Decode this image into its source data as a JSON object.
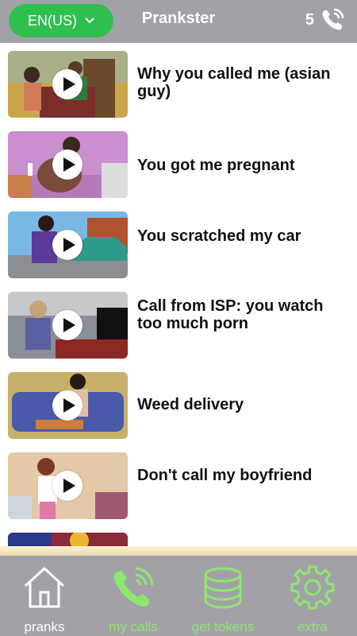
{
  "header": {
    "language": "EN(US)",
    "title": "Prankster",
    "token_count": "5",
    "brand_color": "#2fbf4f",
    "bar_color": "#a3a1a8"
  },
  "pranks": [
    {
      "title": "Why you called me (asian guy)"
    },
    {
      "title": "You got me pregnant"
    },
    {
      "title": "You scratched my car"
    },
    {
      "title": "Call from ISP: you watch too much porn"
    },
    {
      "title": "Weed delivery"
    },
    {
      "title": "Don't call my boyfriend"
    }
  ],
  "nav": {
    "pranks": "pranks",
    "my_calls": "my calls",
    "get_tokens": "get tokens",
    "extra": "extra",
    "active_color": "#ffffff",
    "inactive_color": "#8ee76d"
  }
}
